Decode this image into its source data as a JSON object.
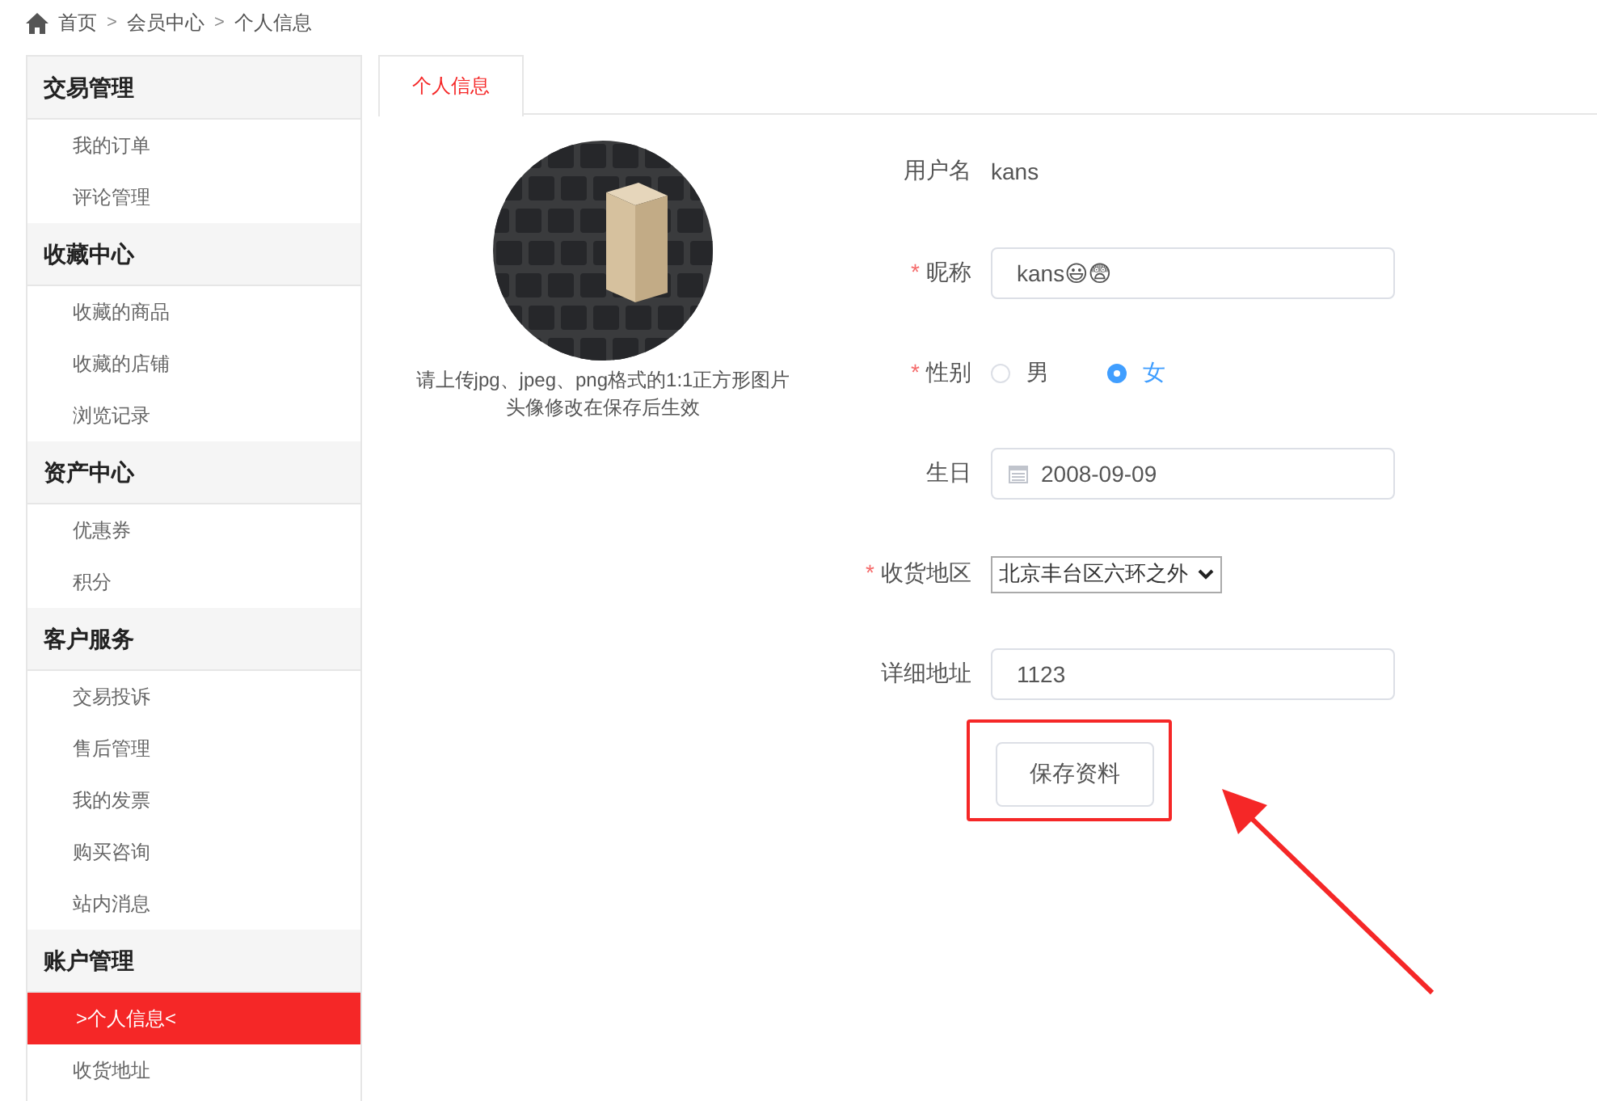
{
  "breadcrumb": [
    "首页",
    "会员中心",
    "个人信息"
  ],
  "breadcrumb_separator": ">",
  "sidebar": [
    {
      "title": "交易管理",
      "items": [
        {
          "label": "我的订单",
          "selected": false
        },
        {
          "label": "评论管理",
          "selected": false
        }
      ]
    },
    {
      "title": "收藏中心",
      "items": [
        {
          "label": "收藏的商品",
          "selected": false
        },
        {
          "label": "收藏的店铺",
          "selected": false
        },
        {
          "label": "浏览记录",
          "selected": false
        }
      ]
    },
    {
      "title": "资产中心",
      "items": [
        {
          "label": "优惠券",
          "selected": false
        },
        {
          "label": "积分",
          "selected": false
        }
      ]
    },
    {
      "title": "客户服务",
      "items": [
        {
          "label": "交易投诉",
          "selected": false
        },
        {
          "label": "售后管理",
          "selected": false
        },
        {
          "label": "我的发票",
          "selected": false
        },
        {
          "label": "购买咨询",
          "selected": false
        },
        {
          "label": "站内消息",
          "selected": false
        }
      ]
    },
    {
      "title": "账户管理",
      "items": [
        {
          "label": ">个人信息<",
          "selected": true
        },
        {
          "label": "收货地址",
          "selected": false
        }
      ]
    }
  ],
  "tabs": [
    {
      "label": "个人信息",
      "selected": true
    }
  ],
  "avatar": {
    "kind": "picture",
    "hint_lines": [
      "请上传jpg、jpeg、png格式的1:1正方形图片",
      "头像修改在保存后生效"
    ]
  },
  "form": [
    {
      "kind": "text",
      "label": "用户名",
      "required": false,
      "value": "kans"
    },
    {
      "kind": "input",
      "label": "昵称",
      "required": true,
      "value": "kans😃😨"
    },
    {
      "kind": "radio",
      "label": "性别",
      "required": true,
      "options": [
        {
          "label": "男",
          "selected": false
        },
        {
          "label": "女",
          "selected": true
        }
      ]
    },
    {
      "kind": "date",
      "label": "生日",
      "required": false,
      "value": "2008-09-09"
    },
    {
      "kind": "select",
      "label": "收货地区",
      "required": true,
      "value": "北京丰台区六环之外"
    },
    {
      "kind": "input",
      "label": "详细地址",
      "required": false,
      "value": "1123"
    }
  ],
  "required_mark": "*",
  "save_button": {
    "label": "保存资料"
  }
}
